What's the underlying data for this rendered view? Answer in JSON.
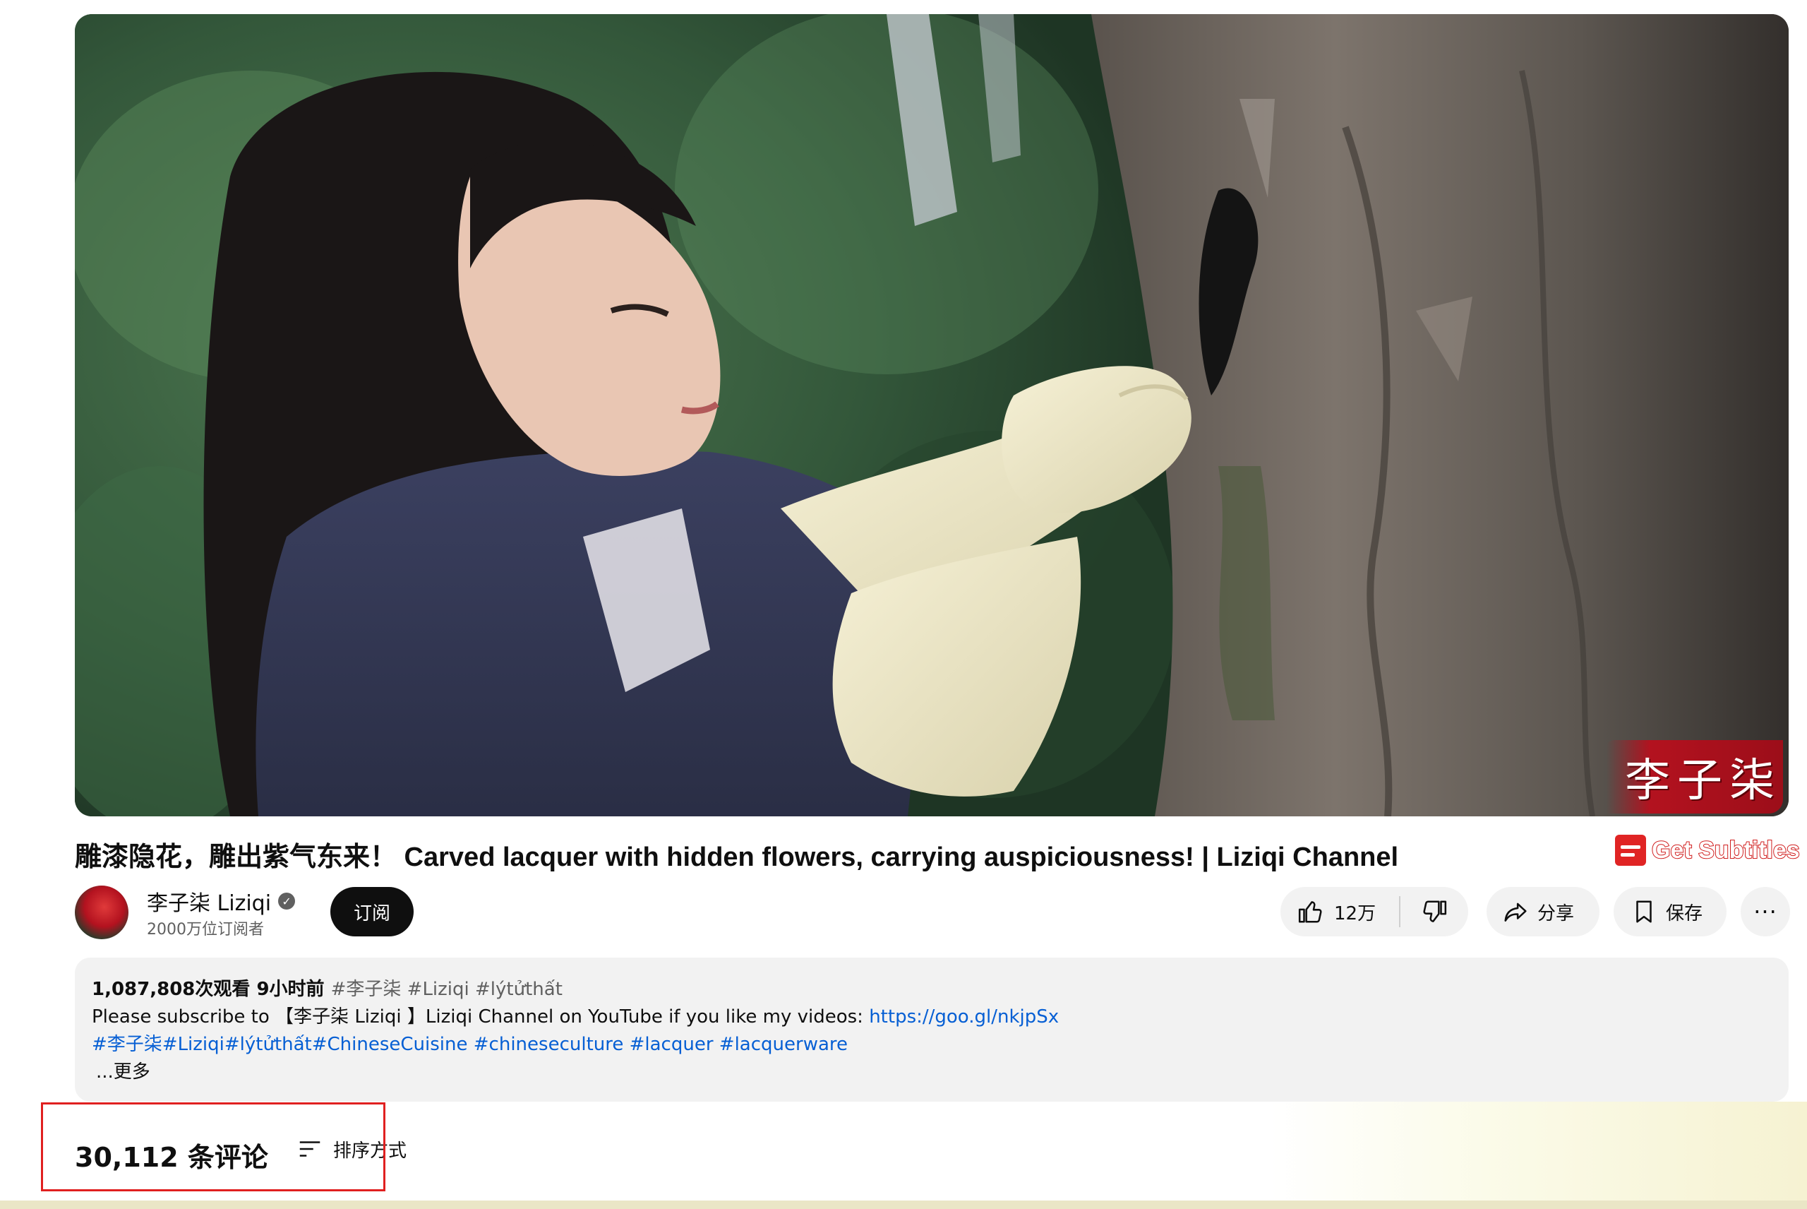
{
  "video": {
    "watermark": "李子柒"
  },
  "title": "雕漆隐花，雕出紫气东来！ Carved lacquer with hidden flowers, carrying auspiciousness! | Liziqi Channel",
  "get_subtitles": "Get Subtitles",
  "channel": {
    "name": "李子柒 Liziqi",
    "verified_glyph": "✓",
    "subscribers": "2000万位订阅者",
    "subscribe_label": "订阅"
  },
  "actions": {
    "like_count": "12万",
    "share_label": "分享",
    "save_label": "保存",
    "more_label": "···"
  },
  "description": {
    "views": "1,087,808次观看",
    "time_ago": "9小时前",
    "tags": "#李子柒 #Liziqi #lýtửthất",
    "line1_text": "Please  subscribe to 【李子柒 Liziqi 】Liziqi Channel on YouTube if you like my videos: ",
    "line1_link": "https://goo.gl/nkjpSx",
    "line2_tags": "#李子柒#Liziqi#lýtửthất#ChineseCuisine #chineseculture #lacquer #lacquerware",
    "more_label": "...更多"
  },
  "comments": {
    "count_label": "30,112 条评论",
    "sort_label": "排序方式"
  },
  "colors": {
    "accent_red": "#e02020",
    "link_blue": "#065fd4",
    "subscribe_bg": "#0f0f0f",
    "pill_bg": "#f2f2f2"
  },
  "icons": [
    "thumbs-up-icon",
    "thumbs-down-icon",
    "share-icon",
    "bookmark-icon",
    "more-icon",
    "sort-icon",
    "verified-icon",
    "subtitles-icon"
  ]
}
